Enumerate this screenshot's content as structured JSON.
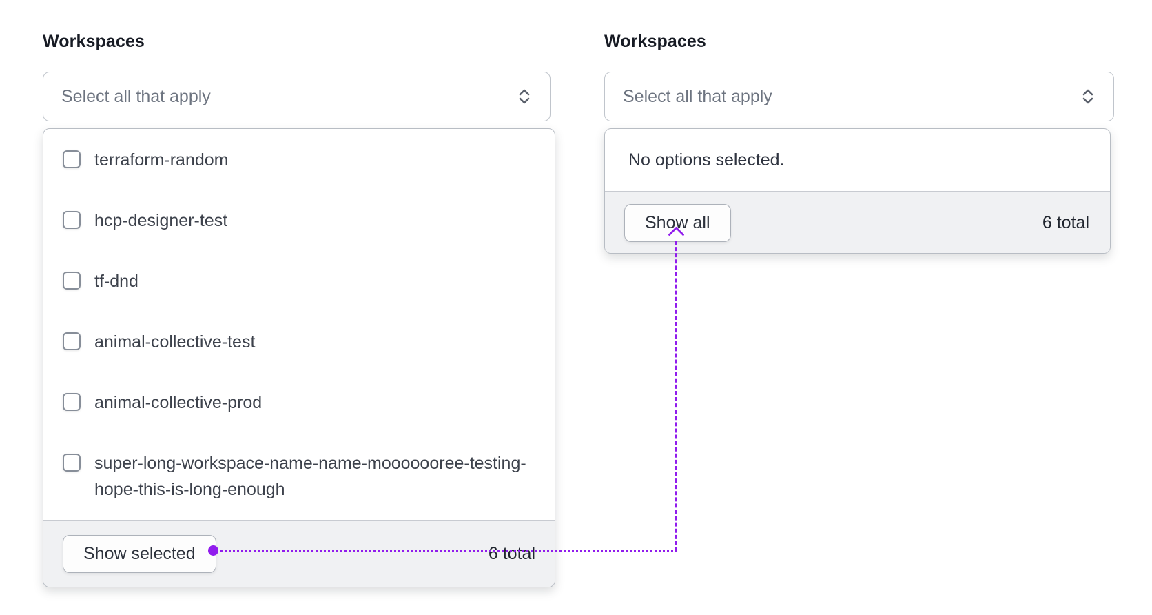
{
  "colors": {
    "accent_purple": "#911ced",
    "panel_border": "#b8bdc4",
    "footer_background": "#f0f1f3",
    "text_primary": "#1d212b",
    "text_secondary": "#3d424c",
    "placeholder": "#6d7480"
  },
  "left_dropdown": {
    "label": "Workspaces",
    "placeholder": "Select all that apply",
    "options": [
      {
        "label": "terraform-random",
        "checked": false
      },
      {
        "label": "hcp-designer-test",
        "checked": false
      },
      {
        "label": "tf-dnd",
        "checked": false
      },
      {
        "label": "animal-collective-test",
        "checked": false
      },
      {
        "label": "animal-collective-prod",
        "checked": false
      },
      {
        "label": "super-long-workspace-name-name-mooooooree-testing-hope-this-is-long-enough",
        "checked": false
      }
    ],
    "footer": {
      "button_label": "Show selected",
      "total": "6 total"
    }
  },
  "right_dropdown": {
    "label": "Workspaces",
    "placeholder": "Select all that apply",
    "empty_message": "No options selected.",
    "footer": {
      "button_label": "Show all",
      "total": "6 total"
    }
  }
}
